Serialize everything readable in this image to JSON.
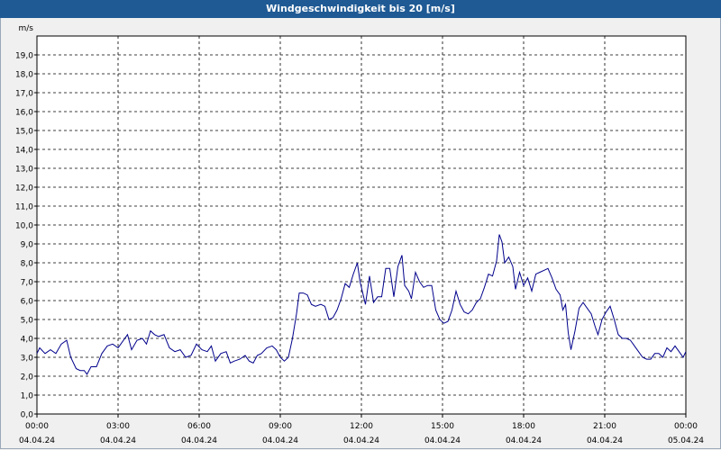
{
  "window": {
    "title": "Windgeschwindigkeit bis 20 [m/s]"
  },
  "colors": {
    "titlebar": "#1f5a94",
    "line": "#00008b",
    "grid": "#000000",
    "background": "#ffffff"
  },
  "chart_data": {
    "type": "line",
    "title": "Windgeschwindigkeit bis 20 [m/s]",
    "ylabel": "m/s",
    "xlabel": "",
    "ylim": [
      0,
      20
    ],
    "y_ticks": [
      "0,0",
      "1,0",
      "2,0",
      "3,0",
      "4,0",
      "5,0",
      "6,0",
      "7,0",
      "8,0",
      "9,0",
      "10,0",
      "11,0",
      "12,0",
      "13,0",
      "14,0",
      "15,0",
      "16,0",
      "17,0",
      "18,0",
      "19,0"
    ],
    "x_ticks": [
      {
        "time": "00:00",
        "date": "04.04.24"
      },
      {
        "time": "03:00",
        "date": "04.04.24"
      },
      {
        "time": "06:00",
        "date": "04.04.24"
      },
      {
        "time": "09:00",
        "date": "04.04.24"
      },
      {
        "time": "12:00",
        "date": "04.04.24"
      },
      {
        "time": "15:00",
        "date": "04.04.24"
      },
      {
        "time": "18:00",
        "date": "04.04.24"
      },
      {
        "time": "21:00",
        "date": "04.04.24"
      },
      {
        "time": "00:00",
        "date": "05.04.24"
      }
    ],
    "xlim_hours": [
      0,
      24
    ],
    "grid": true,
    "series": [
      {
        "values": [
          [
            0.0,
            3.2
          ],
          [
            0.1,
            3.5
          ],
          [
            0.3,
            3.2
          ],
          [
            0.5,
            3.4
          ],
          [
            0.7,
            3.2
          ],
          [
            0.9,
            3.7
          ],
          [
            1.1,
            3.9
          ],
          [
            1.25,
            3.0
          ],
          [
            1.45,
            2.4
          ],
          [
            1.6,
            2.3
          ],
          [
            1.75,
            2.3
          ],
          [
            1.85,
            2.1
          ],
          [
            2.0,
            2.5
          ],
          [
            2.2,
            2.5
          ],
          [
            2.4,
            3.2
          ],
          [
            2.6,
            3.6
          ],
          [
            2.8,
            3.7
          ],
          [
            3.0,
            3.5
          ],
          [
            3.2,
            3.9
          ],
          [
            3.35,
            4.2
          ],
          [
            3.5,
            3.4
          ],
          [
            3.7,
            3.9
          ],
          [
            3.9,
            4.0
          ],
          [
            4.05,
            3.7
          ],
          [
            4.2,
            4.4
          ],
          [
            4.35,
            4.2
          ],
          [
            4.5,
            4.1
          ],
          [
            4.7,
            4.2
          ],
          [
            4.9,
            3.5
          ],
          [
            5.1,
            3.3
          ],
          [
            5.3,
            3.4
          ],
          [
            5.5,
            3.0
          ],
          [
            5.7,
            3.1
          ],
          [
            5.9,
            3.7
          ],
          [
            6.1,
            3.4
          ],
          [
            6.3,
            3.3
          ],
          [
            6.45,
            3.6
          ],
          [
            6.6,
            2.8
          ],
          [
            6.8,
            3.2
          ],
          [
            7.0,
            3.3
          ],
          [
            7.15,
            2.7
          ],
          [
            7.3,
            2.8
          ],
          [
            7.5,
            2.9
          ],
          [
            7.7,
            3.1
          ],
          [
            7.85,
            2.8
          ],
          [
            8.0,
            2.7
          ],
          [
            8.15,
            3.1
          ],
          [
            8.3,
            3.2
          ],
          [
            8.5,
            3.5
          ],
          [
            8.7,
            3.6
          ],
          [
            8.85,
            3.4
          ],
          [
            9.0,
            3.0
          ],
          [
            9.15,
            2.8
          ],
          [
            9.3,
            3.0
          ],
          [
            9.45,
            4.0
          ],
          [
            9.6,
            5.3
          ],
          [
            9.7,
            6.4
          ],
          [
            9.85,
            6.4
          ],
          [
            10.0,
            6.3
          ],
          [
            10.15,
            5.8
          ],
          [
            10.3,
            5.7
          ],
          [
            10.5,
            5.8
          ],
          [
            10.65,
            5.7
          ],
          [
            10.8,
            5.0
          ],
          [
            10.95,
            5.1
          ],
          [
            11.1,
            5.5
          ],
          [
            11.25,
            6.1
          ],
          [
            11.4,
            6.9
          ],
          [
            11.55,
            6.7
          ],
          [
            11.7,
            7.4
          ],
          [
            11.85,
            8.0
          ],
          [
            11.95,
            7.0
          ],
          [
            12.05,
            6.4
          ],
          [
            12.15,
            5.8
          ],
          [
            12.3,
            7.3
          ],
          [
            12.45,
            5.9
          ],
          [
            12.6,
            6.2
          ],
          [
            12.75,
            6.2
          ],
          [
            12.9,
            7.7
          ],
          [
            13.05,
            7.7
          ],
          [
            13.2,
            6.2
          ],
          [
            13.35,
            7.8
          ],
          [
            13.5,
            8.4
          ],
          [
            13.6,
            6.8
          ],
          [
            13.75,
            6.5
          ],
          [
            13.85,
            6.1
          ],
          [
            14.0,
            7.5
          ],
          [
            14.15,
            7.0
          ],
          [
            14.3,
            6.7
          ],
          [
            14.45,
            6.8
          ],
          [
            14.6,
            6.8
          ],
          [
            14.75,
            5.5
          ],
          [
            14.9,
            5.0
          ],
          [
            15.05,
            4.8
          ],
          [
            15.2,
            4.9
          ],
          [
            15.35,
            5.5
          ],
          [
            15.5,
            6.5
          ],
          [
            15.65,
            5.8
          ],
          [
            15.8,
            5.4
          ],
          [
            15.95,
            5.3
          ],
          [
            16.1,
            5.5
          ],
          [
            16.25,
            5.9
          ],
          [
            16.4,
            6.1
          ],
          [
            16.55,
            6.7
          ],
          [
            16.7,
            7.4
          ],
          [
            16.85,
            7.3
          ],
          [
            17.0,
            8.1
          ],
          [
            17.1,
            9.5
          ],
          [
            17.2,
            9.1
          ],
          [
            17.3,
            8.0
          ],
          [
            17.45,
            8.3
          ],
          [
            17.6,
            7.8
          ],
          [
            17.7,
            6.6
          ],
          [
            17.85,
            7.5
          ],
          [
            18.0,
            6.8
          ],
          [
            18.15,
            7.2
          ],
          [
            18.3,
            6.5
          ],
          [
            18.45,
            7.4
          ],
          [
            18.6,
            7.5
          ],
          [
            18.75,
            7.6
          ],
          [
            18.9,
            7.7
          ],
          [
            19.05,
            7.2
          ],
          [
            19.2,
            6.6
          ],
          [
            19.35,
            6.3
          ],
          [
            19.45,
            5.5
          ],
          [
            19.55,
            5.8
          ],
          [
            19.65,
            4.3
          ],
          [
            19.75,
            3.4
          ],
          [
            19.9,
            4.4
          ],
          [
            20.05,
            5.6
          ],
          [
            20.2,
            5.9
          ],
          [
            20.35,
            5.6
          ],
          [
            20.5,
            5.3
          ],
          [
            20.65,
            4.6
          ],
          [
            20.75,
            4.2
          ],
          [
            20.9,
            5.0
          ],
          [
            21.05,
            5.4
          ],
          [
            21.2,
            5.7
          ],
          [
            21.35,
            5.0
          ],
          [
            21.5,
            4.2
          ],
          [
            21.65,
            4.0
          ],
          [
            21.8,
            4.0
          ],
          [
            21.95,
            3.9
          ],
          [
            22.1,
            3.6
          ],
          [
            22.25,
            3.3
          ],
          [
            22.4,
            3.0
          ],
          [
            22.55,
            2.9
          ],
          [
            22.7,
            2.9
          ],
          [
            22.85,
            3.2
          ],
          [
            23.0,
            3.2
          ],
          [
            23.15,
            3.0
          ],
          [
            23.3,
            3.5
          ],
          [
            23.45,
            3.3
          ],
          [
            23.6,
            3.6
          ],
          [
            23.75,
            3.3
          ],
          [
            23.9,
            3.0
          ],
          [
            24.0,
            3.3
          ]
        ]
      }
    ]
  }
}
